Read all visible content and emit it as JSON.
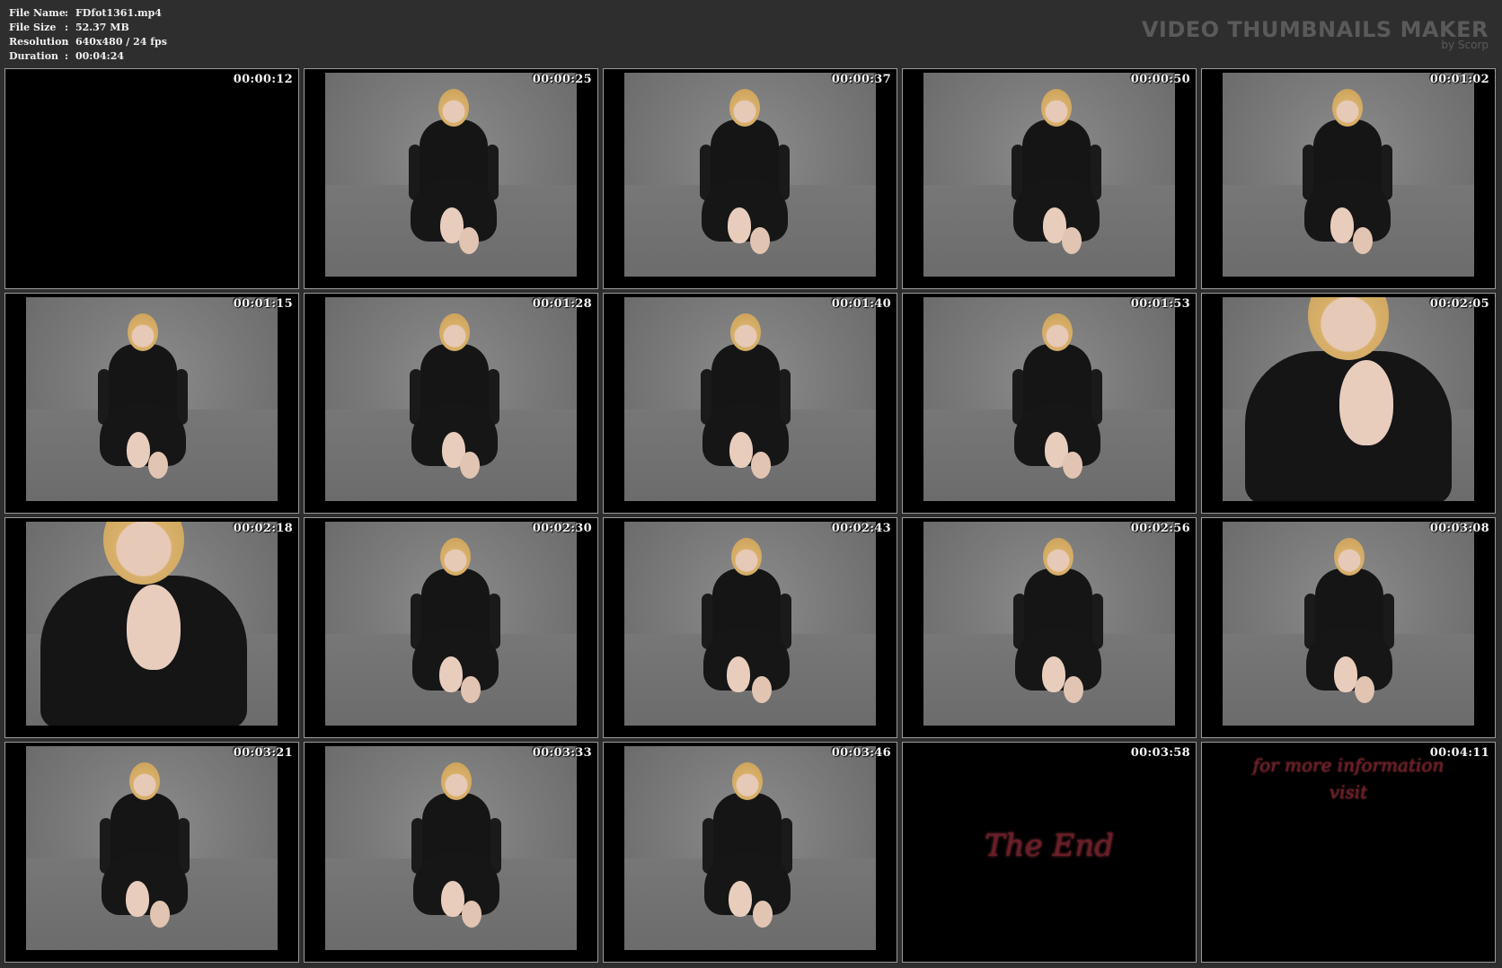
{
  "meta": {
    "file_name_label": "File Name",
    "file_name_value": "FDfot1361.mp4",
    "file_size_label": "File Size",
    "file_size_value": "52.37 MB",
    "resolution_label": "Resolution",
    "resolution_value": "640x480 / 24 fps",
    "duration_label": "Duration",
    "duration_value": "00:04:24",
    "separator": ":"
  },
  "brand": {
    "title": "VIDEO THUMBNAILS MAKER",
    "subtitle": "by Scorp"
  },
  "thumbnails": [
    {
      "time": "00:00:12",
      "kind": "black"
    },
    {
      "time": "00:00:25",
      "kind": "seated"
    },
    {
      "time": "00:00:37",
      "kind": "seated"
    },
    {
      "time": "00:00:50",
      "kind": "seated"
    },
    {
      "time": "00:01:02",
      "kind": "seated"
    },
    {
      "time": "00:01:15",
      "kind": "seated"
    },
    {
      "time": "00:01:28",
      "kind": "seated"
    },
    {
      "time": "00:01:40",
      "kind": "seated"
    },
    {
      "time": "00:01:53",
      "kind": "seated"
    },
    {
      "time": "00:02:05",
      "kind": "closeup"
    },
    {
      "time": "00:02:18",
      "kind": "closeup"
    },
    {
      "time": "00:02:30",
      "kind": "seated"
    },
    {
      "time": "00:02:43",
      "kind": "seated"
    },
    {
      "time": "00:02:56",
      "kind": "seated"
    },
    {
      "time": "00:03:08",
      "kind": "seated"
    },
    {
      "time": "00:03:21",
      "kind": "seated"
    },
    {
      "time": "00:03:33",
      "kind": "seated"
    },
    {
      "time": "00:03:46",
      "kind": "seated"
    },
    {
      "time": "00:03:58",
      "kind": "end",
      "text": "The End"
    },
    {
      "time": "00:04:11",
      "kind": "info",
      "text_line1": "for more information",
      "text_line2": "visit"
    }
  ]
}
